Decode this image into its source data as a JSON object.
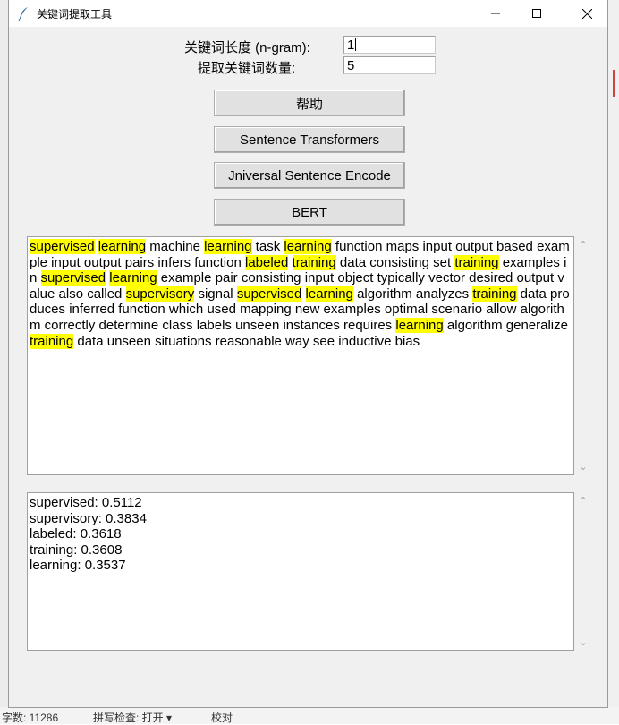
{
  "window": {
    "title": "关键词提取工具"
  },
  "controls": {
    "ngram_label": "关键词长度 (n-gram):",
    "ngram_value": "1",
    "count_label": "提取关键词数量:",
    "count_value": "5"
  },
  "buttons": {
    "help": "帮助",
    "sentence_transformers": "Sentence Transformers",
    "universal_sentence_encoder": "Jniversal Sentence Encode",
    "bert": "BERT"
  },
  "text_input": {
    "segments": [
      {
        "t": "supervised",
        "hl": true
      },
      {
        "t": " "
      },
      {
        "t": "learning",
        "hl": true
      },
      {
        "t": " machine "
      },
      {
        "t": "learning",
        "hl": true
      },
      {
        "t": " task "
      },
      {
        "t": "learning",
        "hl": true
      },
      {
        "t": " function maps input output based example input output pairs infers function "
      },
      {
        "t": "labeled",
        "hl": true
      },
      {
        "t": " "
      },
      {
        "t": "training",
        "hl": true
      },
      {
        "t": " data consisting set "
      },
      {
        "t": "training",
        "hl": true
      },
      {
        "t": " examples in "
      },
      {
        "t": "supervised",
        "hl": true
      },
      {
        "t": " "
      },
      {
        "t": "learning",
        "hl": true
      },
      {
        "t": " example pair consisting input object typically vector desired output value also called "
      },
      {
        "t": "supervisory",
        "hl": true
      },
      {
        "t": " signal "
      },
      {
        "t": "supervised",
        "hl": true
      },
      {
        "t": " "
      },
      {
        "t": "learning",
        "hl": true
      },
      {
        "t": " algorithm analyzes "
      },
      {
        "t": "training",
        "hl": true
      },
      {
        "t": " data produces inferred function which used mapping new examples optimal scenario allow algorithm correctly determine class labels unseen instances requires "
      },
      {
        "t": "learning",
        "hl": true
      },
      {
        "t": " algorithm generalize "
      },
      {
        "t": "training",
        "hl": true
      },
      {
        "t": " data unseen situations reasonable way see inductive bias"
      }
    ]
  },
  "results": [
    "supervised: 0.5112",
    "supervisory: 0.3834",
    "labeled: 0.3618",
    "training: 0.3608",
    "learning: 0.3537"
  ],
  "background": {
    "status_words": "字数: 11286",
    "status_spell": "拼写检查: 打开 ▾",
    "status_proof": "校对"
  },
  "colors": {
    "highlight": "#ffff00",
    "window_bg": "#f0f0f0",
    "button_bg": "#e1e1e1"
  }
}
